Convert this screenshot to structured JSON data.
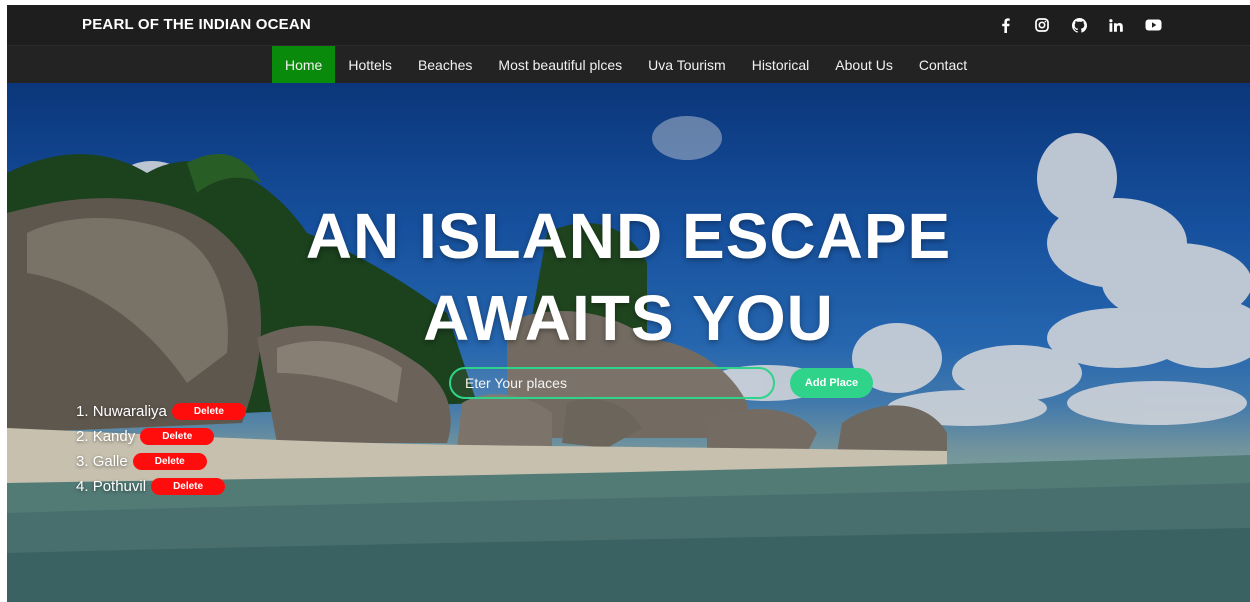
{
  "brand": "PEARL OF THE INDIAN OCEAN",
  "socials": [
    {
      "icon": "facebook-icon"
    },
    {
      "icon": "instagram-icon"
    },
    {
      "icon": "github-icon"
    },
    {
      "icon": "linkedin-icon"
    },
    {
      "icon": "youtube-icon"
    }
  ],
  "nav": {
    "items": [
      {
        "label": "Home",
        "active": true
      },
      {
        "label": "Hottels"
      },
      {
        "label": "Beaches"
      },
      {
        "label": "Most beautiful plces"
      },
      {
        "label": "Uva Tourism"
      },
      {
        "label": "Historical"
      },
      {
        "label": "About Us"
      },
      {
        "label": "Contact"
      }
    ],
    "active_color": "#0a8a0a"
  },
  "hero": {
    "headline_line1": "AN ISLAND ESCAPE",
    "headline_line2": "AWAITS YOU",
    "input_placeholder": "Eter Your places",
    "add_button": "Add Place",
    "accent_color": "#2fd48a"
  },
  "places": {
    "items": [
      {
        "number": "1.",
        "name": "Nuwaraliya",
        "delete_label": "Delete"
      },
      {
        "number": "2.",
        "name": "Kandy",
        "delete_label": "Delete"
      },
      {
        "number": "3.",
        "name": "Galle",
        "delete_label": "Delete"
      },
      {
        "number": "4.",
        "name": "Pothuvil",
        "delete_label": "Delete"
      }
    ],
    "delete_color": "#ff0d0d"
  }
}
